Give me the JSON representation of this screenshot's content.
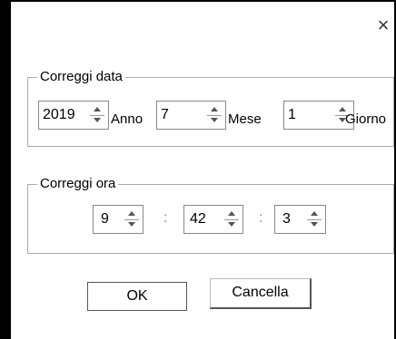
{
  "window": {
    "close_glyph": "×"
  },
  "date_group": {
    "title": "Correggi data",
    "year": {
      "value": "2019",
      "unit": "Anno"
    },
    "month": {
      "value": "7",
      "unit": "Mese"
    },
    "day": {
      "value": "1",
      "unit": "Giorno"
    }
  },
  "time_group": {
    "title": "Correggi ora",
    "hour": "9",
    "minute": "42",
    "second": "3",
    "separator": ":"
  },
  "buttons": {
    "ok": "OK",
    "cancel": "Cancella"
  }
}
